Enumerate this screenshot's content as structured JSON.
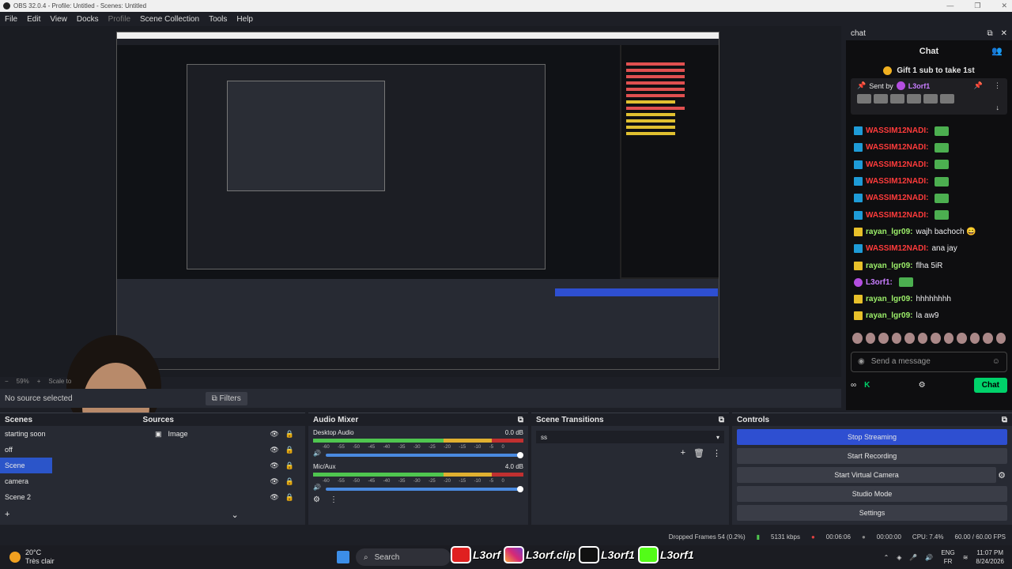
{
  "window": {
    "title": "OBS 32.0.4 - Profile: Untitled - Scenes: Untitled"
  },
  "menu": [
    "File",
    "Edit",
    "View",
    "Docks",
    "Profile",
    "Scene Collection",
    "Tools",
    "Help"
  ],
  "preview": {
    "zoom": "59%",
    "scale_label": "Scale to"
  },
  "source_bar": {
    "no_source": "No source selected",
    "filters": "Filters"
  },
  "chat": {
    "dock_title": "chat",
    "title": "Chat",
    "gift_text": "Gift 1 sub to take 1st",
    "sent_by_label": "Sent by",
    "sent_by_user": "L3orf1",
    "messages": [
      {
        "user": "WASSIM12NADI:",
        "color": "red",
        "badge": "blue",
        "text": ""
      },
      {
        "user": "WASSIM12NADI:",
        "color": "red",
        "badge": "blue",
        "text": ""
      },
      {
        "user": "WASSIM12NADI:",
        "color": "red",
        "badge": "blue",
        "text": ""
      },
      {
        "user": "WASSIM12NADI:",
        "color": "red",
        "badge": "blue",
        "text": ""
      },
      {
        "user": "WASSIM12NADI:",
        "color": "red",
        "badge": "blue",
        "text": ""
      },
      {
        "user": "WASSIM12NADI:",
        "color": "red",
        "badge": "blue",
        "text": ""
      },
      {
        "user": "rayan_lgr09:",
        "color": "green",
        "badge": "yellow",
        "text": "wajh bachoch 😄"
      },
      {
        "user": "WASSIM12NADI:",
        "color": "red",
        "badge": "blue",
        "text": "ana jay"
      },
      {
        "user": "rayan_lgr09:",
        "color": "green",
        "badge": "yellow",
        "text": "flha 5iR"
      },
      {
        "user": "L3orf1:",
        "color": "purple",
        "badge": "purple",
        "text": ""
      },
      {
        "user": "rayan_lgr09:",
        "color": "green",
        "badge": "yellow",
        "text": "hhhhhhhh"
      },
      {
        "user": "rayan_lgr09:",
        "color": "green",
        "badge": "yellow",
        "text": "la aw9"
      }
    ],
    "input_placeholder": "Send a message",
    "chat_button": "Chat"
  },
  "docks": {
    "scenes": {
      "title": "Scenes",
      "items": [
        "starting soon",
        "off",
        "Scene",
        "camera",
        "Scene 2"
      ],
      "selected": 2
    },
    "sources": {
      "title": "Sources",
      "items": [
        "Image"
      ]
    },
    "mixer": {
      "title": "Audio Mixer",
      "tracks": [
        {
          "name": "Desktop Audio",
          "db": "0.0 dB"
        },
        {
          "name": "Mic/Aux",
          "db": "4.0 dB"
        }
      ],
      "ticks": [
        "-60",
        "-55",
        "-50",
        "-45",
        "-40",
        "-35",
        "-30",
        "-25",
        "-20",
        "-15",
        "-10",
        "-5",
        "0"
      ]
    },
    "transitions": {
      "title": "Scene Transitions",
      "selected": "ss"
    },
    "controls": {
      "title": "Controls",
      "buttons": [
        "Stop Streaming",
        "Start Recording",
        "Start Virtual Camera",
        "Studio Mode",
        "Settings"
      ]
    }
  },
  "status": {
    "dropped": "Dropped Frames 54 (0.2%)",
    "bitrate": "5131 kbps",
    "stream_time": "00:06:06",
    "rec_time": "00:00:00",
    "cpu": "CPU: 7.4%",
    "fps": "60.00 / 60.00 FPS"
  },
  "taskbar": {
    "temp": "20°C",
    "weather": "Très clair",
    "search": "Search",
    "lang": "ENG",
    "region": "FR",
    "time": "11:07 PM",
    "date": "8/24/2026"
  },
  "overlay": {
    "youtube": "L3orf",
    "instagram": "L3orf.clip",
    "tiktok": "L3orf1",
    "kick": "L3orf1"
  },
  "colors": {
    "accent": "#2e4fd1",
    "kick_green": "#00d26a",
    "error_red": "#ff3b3b"
  }
}
